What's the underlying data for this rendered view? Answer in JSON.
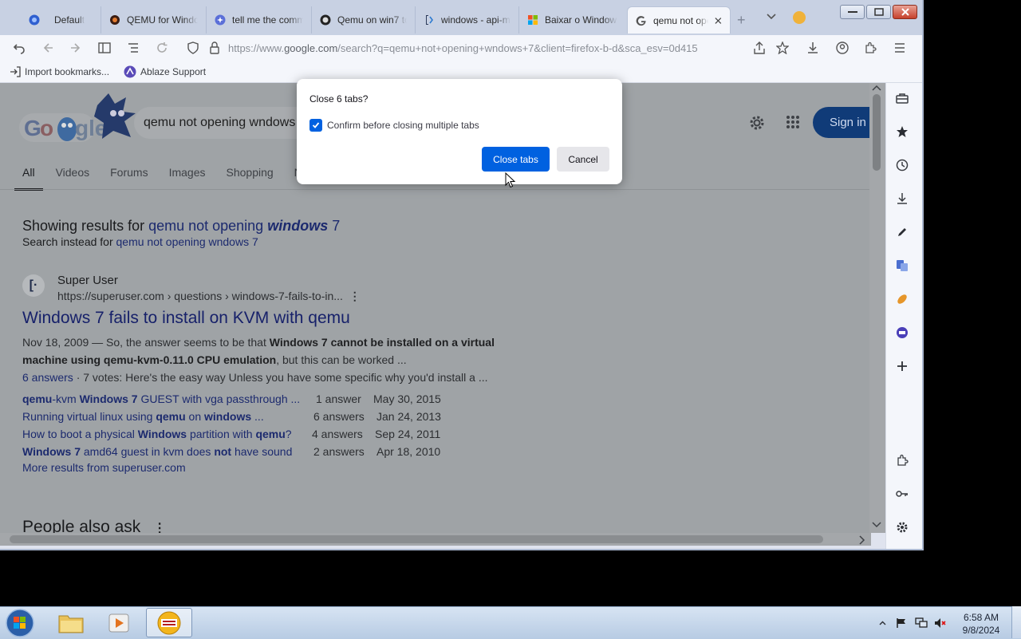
{
  "browser": {
    "tabs": [
      {
        "label": "Default",
        "icon": "profile-icon"
      },
      {
        "label": "QEMU for Windows",
        "icon": "qemu-icon"
      },
      {
        "label": "tell me the commands",
        "icon": "copilot-icon"
      },
      {
        "label": "Qemu on win7 too",
        "icon": "github-icon"
      },
      {
        "label": "windows - api-ms",
        "icon": "superuser-icon"
      },
      {
        "label": "Baixar o Windows",
        "icon": "microsoft-icon"
      },
      {
        "label": "qemu not opening",
        "icon": "google-icon",
        "active": true
      }
    ],
    "url_prefix": "https://www.",
    "url_domain": "google.com",
    "url_rest": "/search?q=qemu+not+opening+wndows+7&client=firefox-b-d&sca_esv=0d415",
    "bookmarks": [
      {
        "label": "Import bookmarks...",
        "icon": "import-icon"
      },
      {
        "label": "Ablaze Support",
        "icon": "ablaze-icon"
      }
    ]
  },
  "google": {
    "query": "qemu not opening wndows 7",
    "signin_label": "Sign in",
    "tabs": [
      "All",
      "Videos",
      "Forums",
      "Images",
      "Shopping",
      "News"
    ],
    "showing_prefix": "Showing results for ",
    "showing_query_plain": "qemu not opening ",
    "showing_query_bold": "windows",
    "showing_query_end": " 7",
    "instead_prefix": "Search instead for ",
    "instead_query": "qemu not opening wndows 7",
    "result": {
      "site_name": "Super User",
      "site_url": "https://superuser.com › questions › windows-7-fails-to-in...",
      "title": "Windows 7 fails to install on KVM with qemu",
      "snippet_date": "Nov 18, 2009 — So, the answer seems to be that ",
      "snippet_bold1": "Windows 7 cannot be installed on a virtual machine using qemu-kvm-0.11.0 CPU emulation",
      "snippet_end": ", but this can be worked ...",
      "answers_link": "6 answers",
      "votes_text": " · 7 votes: Here's the easy way Unless you have some specific why you'd install a ...",
      "sub_results": [
        {
          "t1b": "qemu",
          "t2": "-kvm ",
          "t3b": "Windows 7",
          "t4": " GUEST with vga passthrough ...",
          "count": "1 answer",
          "date": "May 30, 2015"
        },
        {
          "t1b": "",
          "t2": "Running virtual linux using ",
          "t3b": "qemu",
          "t4": " on ",
          "t5b": "windows",
          "t6": " ...",
          "count": "6 answers",
          "date": "Jan 24, 2013"
        },
        {
          "t1b": "",
          "t2": "How to boot a physical ",
          "t3b": "Windows",
          "t4": " partition with ",
          "t5b": "qemu",
          "t6": "?",
          "count": "4 answers",
          "date": "Sep 24, 2011"
        },
        {
          "t1b": "Windows 7",
          "t2": " amd64 guest in kvm does ",
          "t3b": "not",
          "t4": " have sound",
          "count": "2 answers",
          "date": "Apr 18, 2010"
        }
      ],
      "more_link": "More results from superuser.com"
    },
    "people_also_ask": "People also ask"
  },
  "dialog": {
    "title": "Close 6 tabs?",
    "checkbox_label": "Confirm before closing multiple tabs",
    "checkbox_checked": true,
    "confirm_label": "Close tabs",
    "cancel_label": "Cancel"
  },
  "taskbar": {
    "time": "6:58 AM",
    "date": "9/8/2024"
  },
  "colors": {
    "accent": "#0061e0",
    "google_signin": "#103b78"
  }
}
